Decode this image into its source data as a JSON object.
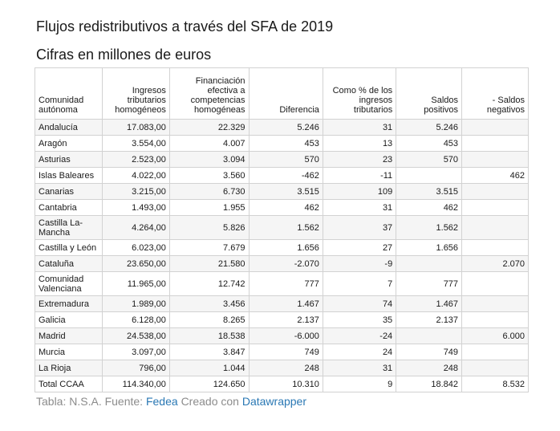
{
  "title": "Flujos redistributivos a través del SFA de 2019",
  "subtitle": "Cifras en millones de euros",
  "table": {
    "headers": [
      "Comunidad autónoma",
      "Ingresos tributarios homogéneos",
      "Financiación efectiva a competencias homogéneas",
      "Diferencia",
      "Como % de los ingresos tributarios",
      "Saldos positivos",
      "- Saldos negativos"
    ],
    "rows": [
      [
        "Andalucía",
        "17.083,00",
        "22.329",
        "5.246",
        "31",
        "5.246",
        ""
      ],
      [
        "Aragón",
        "3.554,00",
        "4.007",
        "453",
        "13",
        "453",
        ""
      ],
      [
        "Asturias",
        "2.523,00",
        "3.094",
        "570",
        "23",
        "570",
        ""
      ],
      [
        "Islas Baleares",
        "4.022,00",
        "3.560",
        "-462",
        "-11",
        "",
        "462"
      ],
      [
        "Canarias",
        "3.215,00",
        "6.730",
        "3.515",
        "109",
        "3.515",
        ""
      ],
      [
        "Cantabria",
        "1.493,00",
        "1.955",
        "462",
        "31",
        "462",
        ""
      ],
      [
        "Castilla La-Mancha",
        "4.264,00",
        "5.826",
        "1.562",
        "37",
        "1.562",
        ""
      ],
      [
        "Castilla y León",
        "6.023,00",
        "7.679",
        "1.656",
        "27",
        "1.656",
        ""
      ],
      [
        "Cataluña",
        "23.650,00",
        "21.580",
        "-2.070",
        "-9",
        "",
        "2.070"
      ],
      [
        "Comunidad Valenciana",
        "11.965,00",
        "12.742",
        "777",
        "7",
        "777",
        ""
      ],
      [
        "Extremadura",
        "1.989,00",
        "3.456",
        "1.467",
        "74",
        "1.467",
        ""
      ],
      [
        "Galicia",
        "6.128,00",
        "8.265",
        "2.137",
        "35",
        "2.137",
        ""
      ],
      [
        "Madrid",
        "24.538,00",
        "18.538",
        "-6.000",
        "-24",
        "",
        "6.000"
      ],
      [
        "Murcia",
        "3.097,00",
        "3.847",
        "749",
        "24",
        "749",
        ""
      ],
      [
        "La Rioja",
        "796,00",
        "1.044",
        "248",
        "31",
        "248",
        ""
      ],
      [
        "Total CCAA",
        "114.340,00",
        "124.650",
        "10.310",
        "9",
        "18.842",
        "8.532"
      ]
    ]
  },
  "footer": {
    "prefix": "Tabla: N.S.A. Fuente:",
    "source_link": "Fedea",
    "created_with": "Creado con",
    "tool_link": "Datawrapper"
  }
}
